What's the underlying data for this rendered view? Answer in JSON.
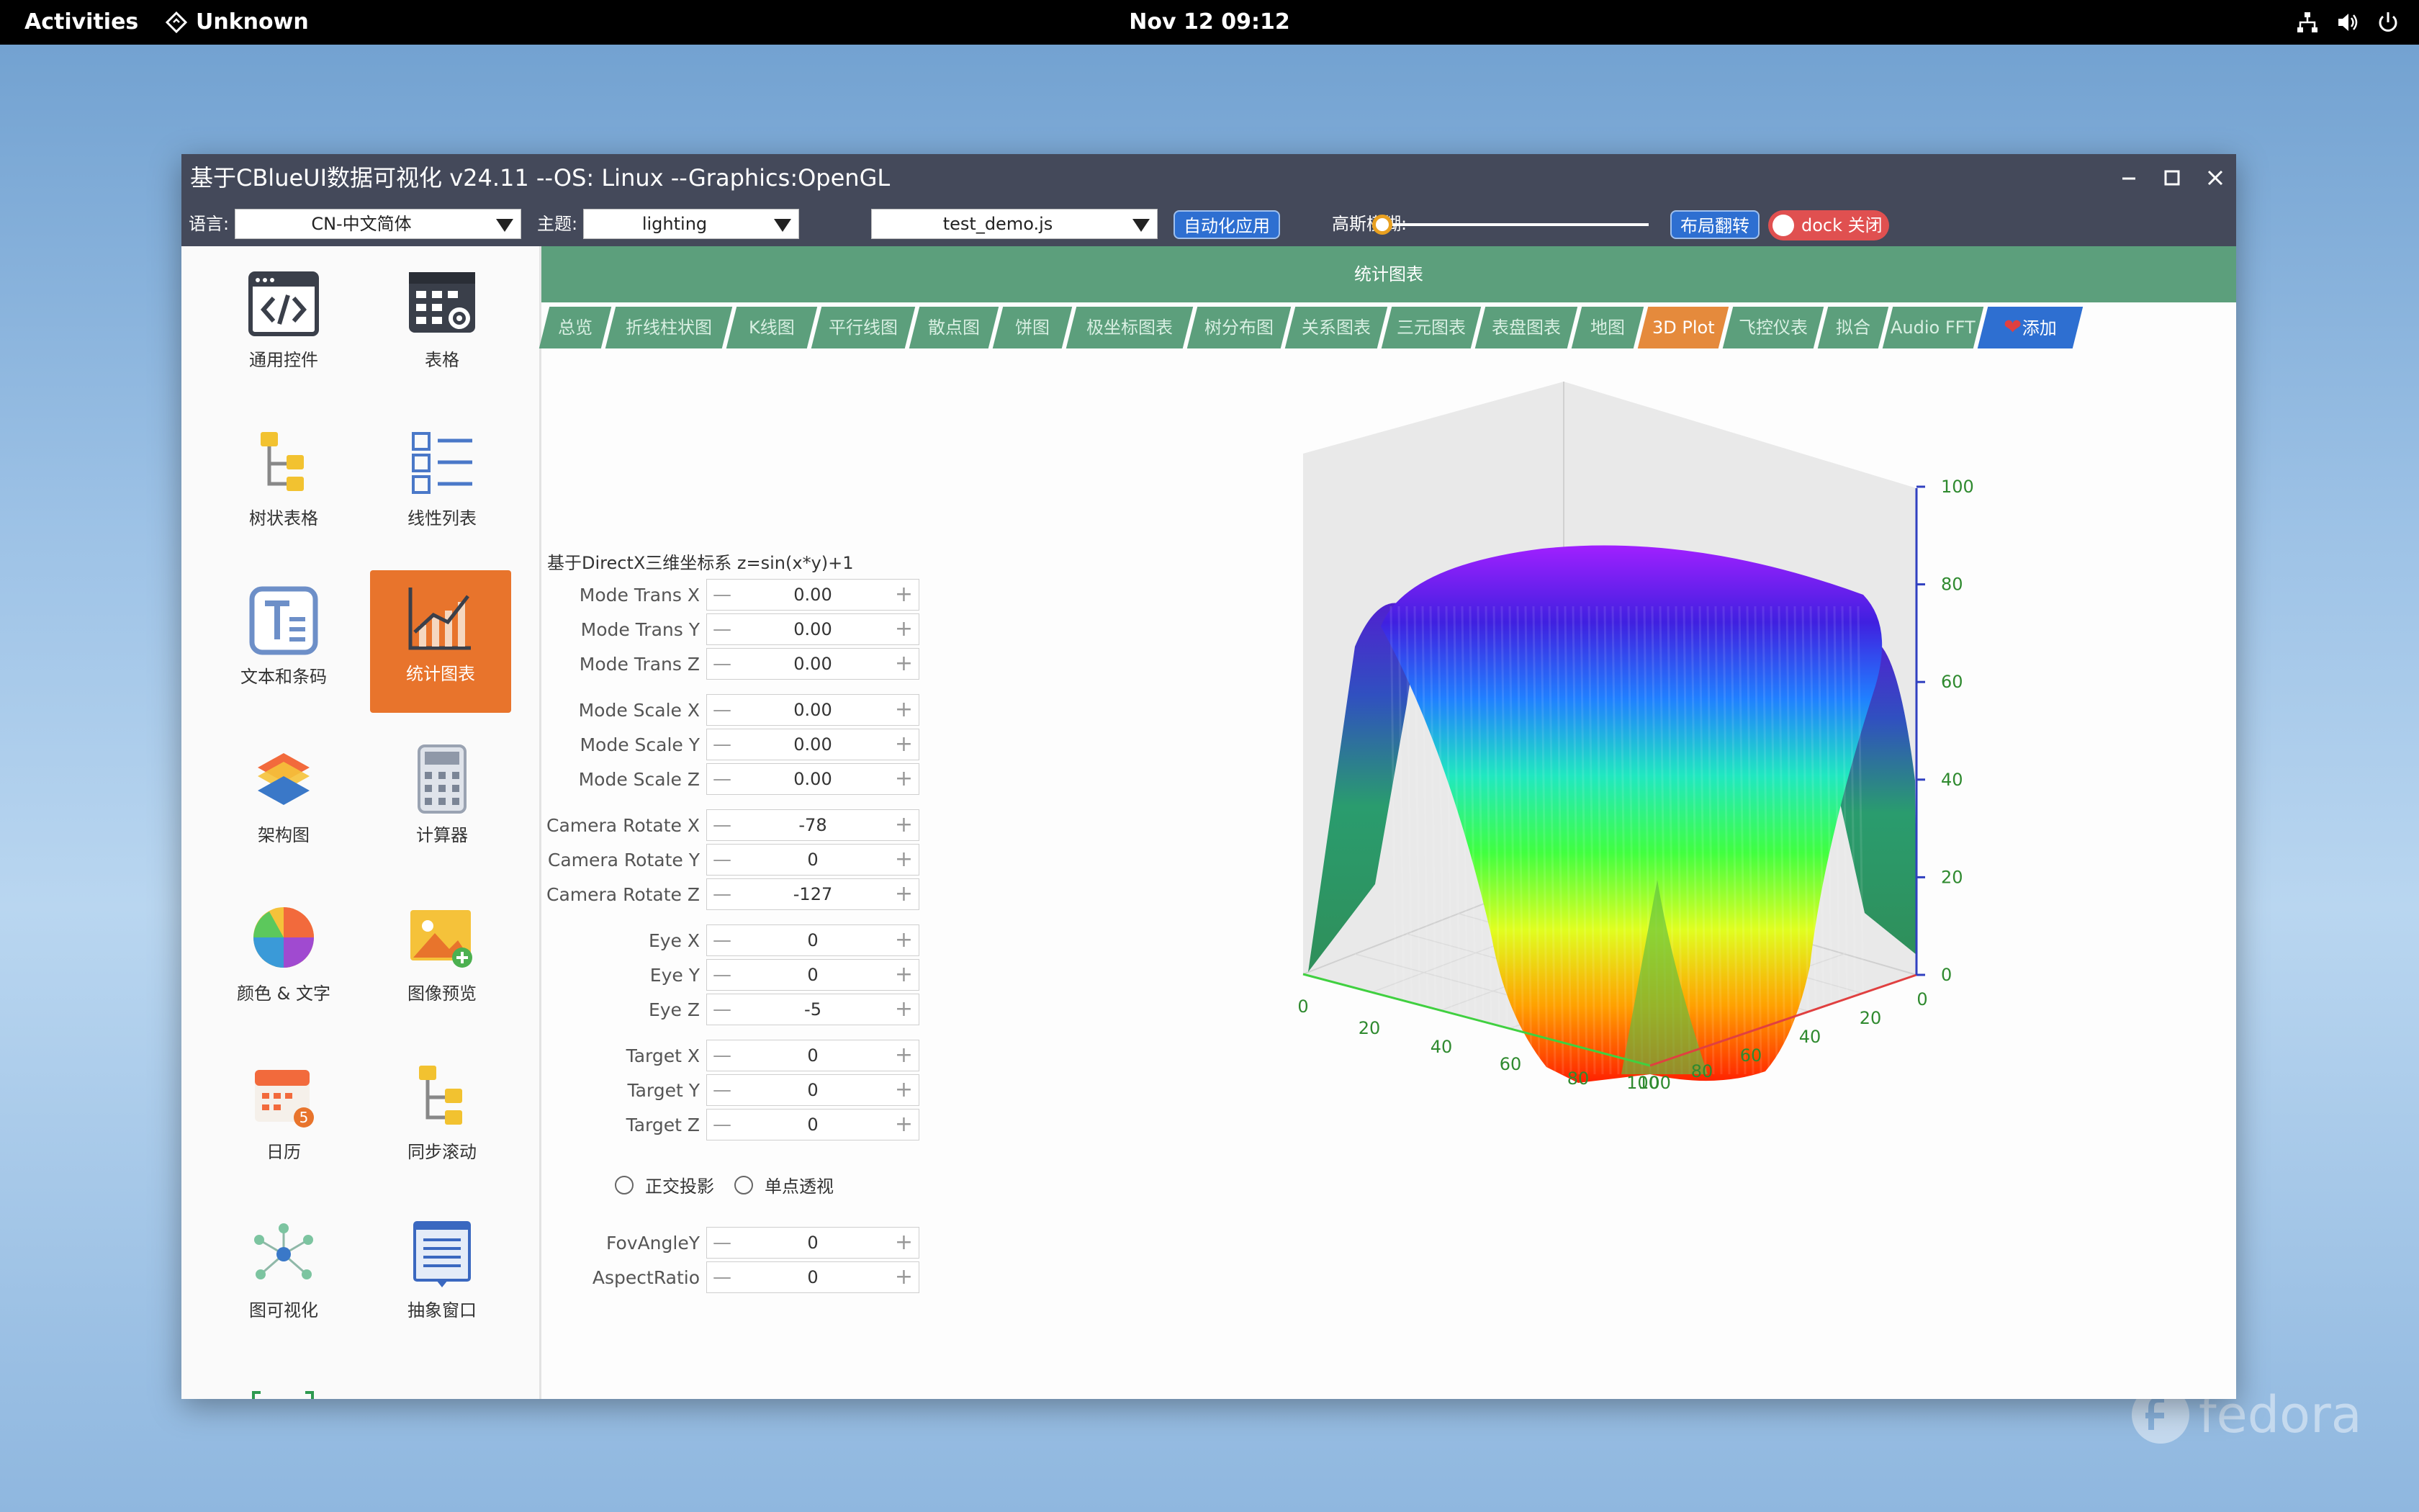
{
  "topbar": {
    "activities": "Activities",
    "app_name": "Unknown",
    "clock": "Nov 12  09:12"
  },
  "watermark": {
    "text": "fedora"
  },
  "window": {
    "title": "基于CBlueUI数据可视化  v24.11  --OS: Linux  --Graphics:OpenGL",
    "toolbar": {
      "lang_label": "语言:",
      "lang_value": "CN-中文简体",
      "theme_label": "主题:",
      "theme_value": "lighting",
      "script_value": "test_demo.js",
      "auto_apply": "自动化应用",
      "blur_label": "高斯模糊:",
      "blur_value": 0,
      "layout_flip": "布局翻转",
      "dock_toggle": "dock 关闭"
    }
  },
  "sidebar": {
    "items": [
      {
        "label": "通用控件",
        "icon": "code-window-icon"
      },
      {
        "label": "表格",
        "icon": "table-settings-icon"
      },
      {
        "label": "树状表格",
        "icon": "tree-table-icon"
      },
      {
        "label": "线性列表",
        "icon": "linear-list-icon"
      },
      {
        "label": "文本和条码",
        "icon": "text-icon"
      },
      {
        "label": "统计图表",
        "icon": "chart-icon"
      },
      {
        "label": "架构图",
        "icon": "layers-icon"
      },
      {
        "label": "计算器",
        "icon": "calculator-icon"
      },
      {
        "label": "颜色 & 文字",
        "icon": "color-wheel-icon"
      },
      {
        "label": "图像预览",
        "icon": "image-preview-icon"
      },
      {
        "label": "日历",
        "icon": "calendar-icon"
      },
      {
        "label": "同步滚动",
        "icon": "sync-scroll-icon"
      },
      {
        "label": "图可视化",
        "icon": "graph-icon"
      },
      {
        "label": "抽象窗口",
        "icon": "abstract-window-icon"
      }
    ],
    "active_index": 5
  },
  "content": {
    "header": "统计图表",
    "tabs": [
      "总览",
      "折线柱状图",
      "K线图",
      "平行线图",
      "散点图",
      "饼图",
      "极坐标图表",
      "树分布图",
      "关系图表",
      "三元图表",
      "表盘图表",
      "地图",
      "3D Plot",
      "飞控仪表",
      "拟合",
      "Audio FFT",
      "添加"
    ],
    "active_tab": "3D Plot",
    "caption": "基于DirectX三维坐标系 z=sin(x*y)+1",
    "groups": [
      [
        {
          "label": "Mode Trans X",
          "value": "0.00"
        },
        {
          "label": "Mode Trans Y",
          "value": "0.00"
        },
        {
          "label": "Mode Trans Z",
          "value": "0.00"
        }
      ],
      [
        {
          "label": "Mode Scale X",
          "value": "0.00"
        },
        {
          "label": "Mode Scale Y",
          "value": "0.00"
        },
        {
          "label": "Mode Scale Z",
          "value": "0.00"
        }
      ],
      [
        {
          "label": "Camera Rotate X",
          "value": "-78"
        },
        {
          "label": "Camera Rotate Y",
          "value": "0"
        },
        {
          "label": "Camera Rotate Z",
          "value": "-127"
        }
      ],
      [
        {
          "label": "Eye X",
          "value": "0"
        },
        {
          "label": "Eye Y",
          "value": "0"
        },
        {
          "label": "Eye Z",
          "value": "-5"
        }
      ],
      [
        {
          "label": "Target X",
          "value": "0"
        },
        {
          "label": "Target Y",
          "value": "0"
        },
        {
          "label": "Target Z",
          "value": "0"
        }
      ]
    ],
    "projection": {
      "ortho": "正交投影",
      "perspective": "单点透视"
    },
    "bottom_fields": [
      {
        "label": "FovAngleY",
        "value": "0"
      },
      {
        "label": "AspectRatio",
        "value": "0"
      }
    ],
    "spin_minus": "—",
    "spin_plus": "+"
  },
  "chart_data": {
    "type": "surface3d",
    "x_ticks": [
      "0",
      "20",
      "40",
      "60",
      "80",
      "100"
    ],
    "y_ticks": [
      "0",
      "20",
      "40",
      "60",
      "80",
      "100"
    ],
    "z_ticks": [
      "0",
      "20",
      "40",
      "60",
      "80",
      "100"
    ],
    "xlim": [
      0,
      100
    ],
    "ylim": [
      0,
      100
    ],
    "zlim": [
      0,
      100
    ],
    "colormap": [
      "#ff2000",
      "#ffa000",
      "#e0ff20",
      "#40ff40",
      "#20e8c0",
      "#2080ff",
      "#4020e0",
      "#a020ff"
    ]
  }
}
